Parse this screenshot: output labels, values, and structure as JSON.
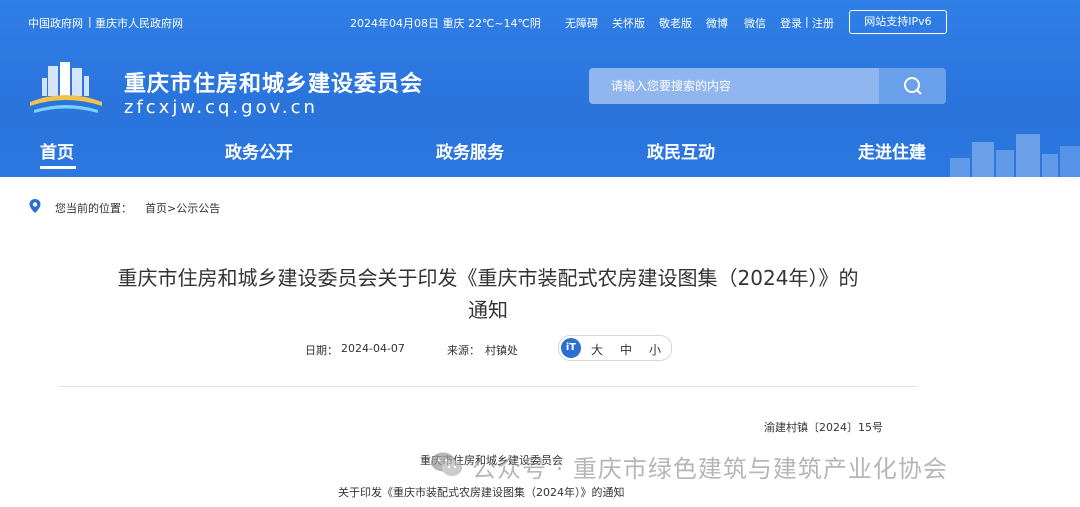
{
  "topbar": {
    "links_left": [
      "中国政府网",
      "重庆市人民政府网"
    ],
    "separator": "|",
    "date_weather": "2024年04月08日 重庆 22℃~14℃阴",
    "links_right": [
      "无障碍",
      "关怀版",
      "敬老版",
      "微博",
      "微信"
    ],
    "login": "登录",
    "register": "注册",
    "ipv6": "网站支持IPv6"
  },
  "site": {
    "title": "重庆市住房和城乡建设委员会",
    "url": "zfcxjw.cq.gov.cn"
  },
  "search": {
    "placeholder": "请输入您要搜索的内容",
    "icon": "search-icon"
  },
  "nav": {
    "items": [
      "首页",
      "政务公开",
      "政务服务",
      "政民互动",
      "走进住建"
    ],
    "active": "首页"
  },
  "breadcrumb": {
    "icon": "location-pin-icon",
    "label": "您当前的位置：",
    "path": "首页>公示公告"
  },
  "article": {
    "title_line1": "重庆市住房和城乡建设委员会关于印发《重庆市装配式农房建设图集（2024年）》的",
    "title_line2": "通知",
    "date_label": "日期：",
    "date": "2024-04-07",
    "source_label": "来源：",
    "source": "村镇处",
    "font_size": {
      "icon_text": "iT",
      "large": "大",
      "medium": "中",
      "small": "小"
    },
    "doc_number": "渝建村镇〔2024〕15号",
    "issuer": "重庆市住房和城乡建设委员会",
    "subject": "关于印发《重庆市装配式农房建设图集（2024年）》的通知"
  },
  "watermark": {
    "text": "公众号 · 重庆市绿色建筑与建筑产业化协会",
    "icon": "wechat-icon"
  },
  "colors": {
    "header": "#2a74dc",
    "accent": "#2d6fd0",
    "search_bg": "#8fb6ee"
  }
}
